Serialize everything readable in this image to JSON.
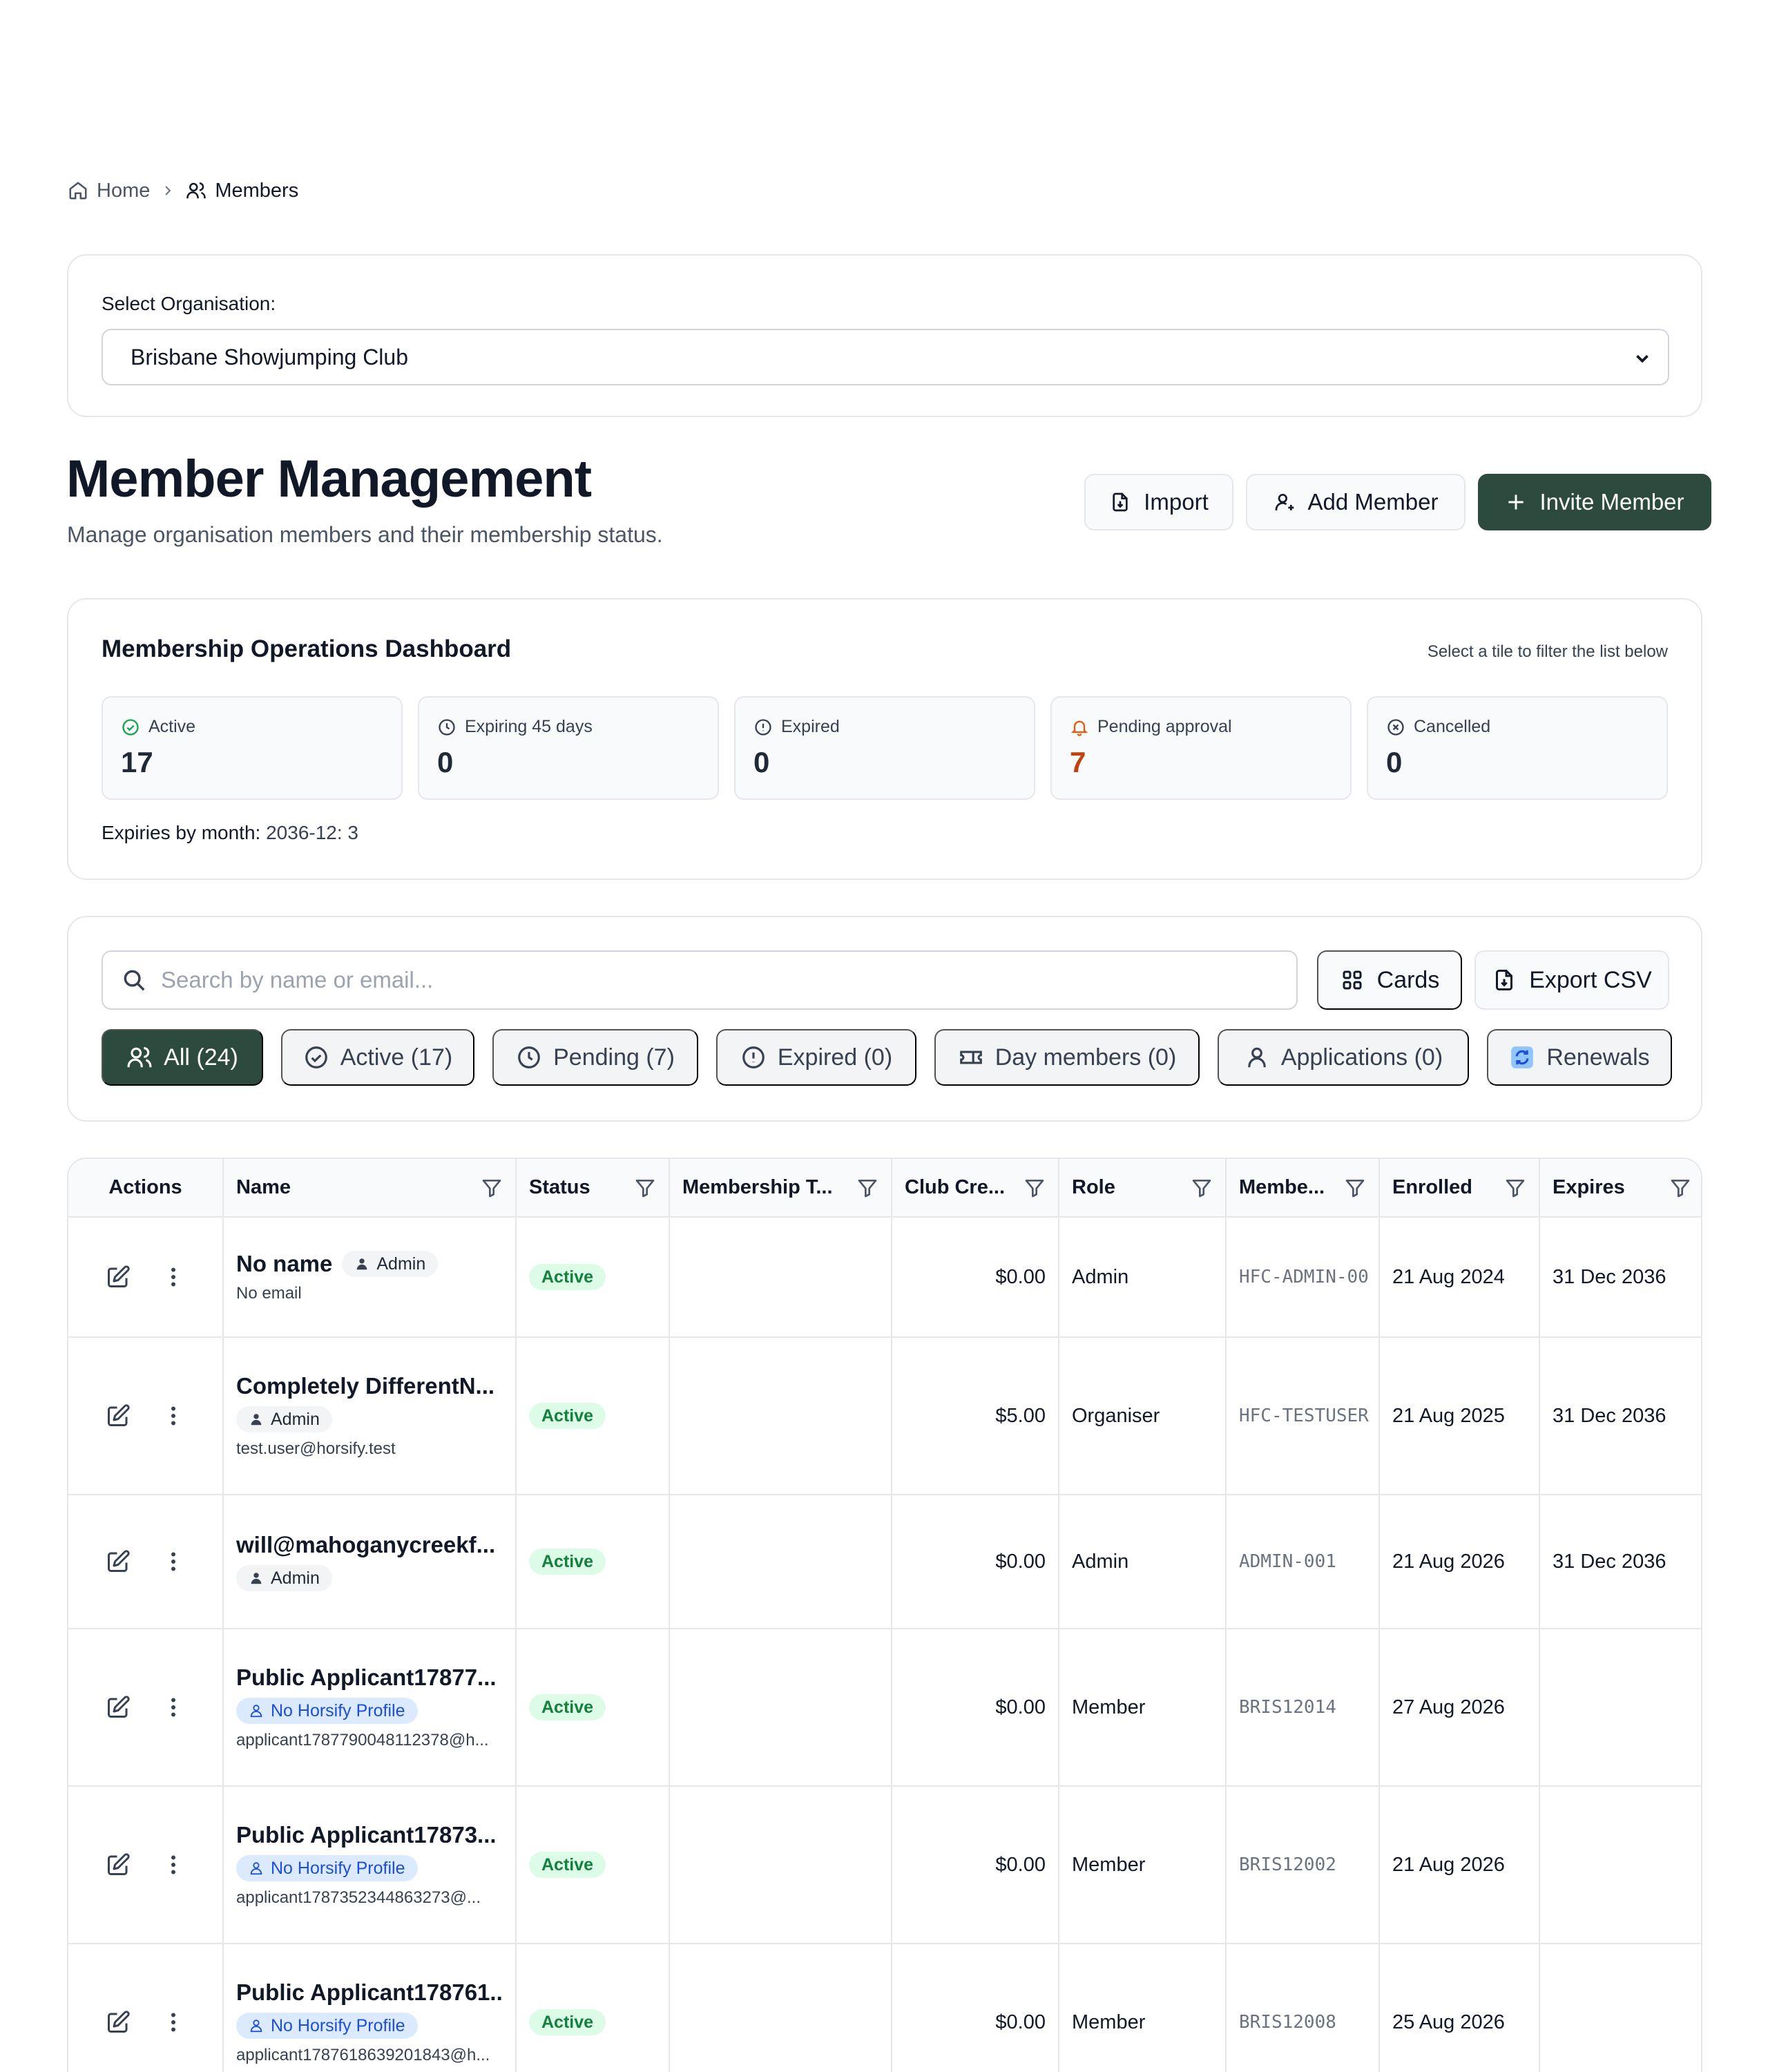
{
  "breadcrumb": {
    "home": "Home",
    "current": "Members"
  },
  "org": {
    "label": "Select Organisation:",
    "selected": "Brisbane Showjumping Club"
  },
  "header": {
    "title": "Member Management",
    "subtitle": "Manage organisation members and their membership status.",
    "import_label": "Import",
    "add_label": "Add Member",
    "invite_label": "Invite Member"
  },
  "dashboard": {
    "title": "Membership Operations Dashboard",
    "hint": "Select a tile to filter the list below",
    "tiles": [
      {
        "label": "Active",
        "value": "17",
        "icon": "check-circle-icon"
      },
      {
        "label": "Expiring 45 days",
        "value": "0",
        "icon": "clock-icon"
      },
      {
        "label": "Expired",
        "value": "0",
        "icon": "alert-circle-icon"
      },
      {
        "label": "Pending approval",
        "value": "7",
        "icon": "bell-icon"
      },
      {
        "label": "Cancelled",
        "value": "0",
        "icon": "x-circle-icon"
      }
    ],
    "expiries_label": "Expiries by month:",
    "expiries_value": "2036-12: 3"
  },
  "toolbar": {
    "search_placeholder": "Search by name or email...",
    "cards_label": "Cards",
    "export_label": "Export CSV",
    "filters": [
      "All (24)",
      "Active (17)",
      "Pending (7)",
      "Expired (0)",
      "Day members (0)",
      "Applications (0)",
      "Renewals"
    ]
  },
  "table": {
    "headers": [
      "Actions",
      "Name",
      "Status",
      "Membership T...",
      "Club Cre...",
      "Role",
      "Membe...",
      "Enrolled",
      "Expires"
    ],
    "rows": [
      {
        "name": "No name",
        "badge": "Admin",
        "email": "No email",
        "status": "Active",
        "membership": "",
        "credit": "$0.00",
        "role": "Admin",
        "member_no": "HFC-ADMIN-00",
        "enrolled": "21 Aug 2024",
        "expires": "31 Dec 2036"
      },
      {
        "name": "Completely DifferentN...",
        "badge": "Admin",
        "email": "test.user@horsify.test",
        "status": "Active",
        "membership": "",
        "credit": "$5.00",
        "role": "Organiser",
        "member_no": "HFC-TESTUSER",
        "enrolled": "21 Aug 2025",
        "expires": "31 Dec 2036"
      },
      {
        "name": "will@mahoganycreekf...",
        "badge": "Admin",
        "email": "",
        "status": "Active",
        "membership": "",
        "credit": "$0.00",
        "role": "Admin",
        "member_no": "ADMIN-001",
        "enrolled": "21 Aug 2026",
        "expires": "31 Dec 2036"
      },
      {
        "name": "Public Applicant17877...",
        "badge": "No Horsify Profile",
        "email": "applicant1787790048112378@h...",
        "status": "Active",
        "membership": "",
        "credit": "$0.00",
        "role": "Member",
        "member_no": "BRIS12014",
        "enrolled": "27 Aug 2026",
        "expires": ""
      },
      {
        "name": "Public Applicant17873...",
        "badge": "No Horsify Profile",
        "email": "applicant1787352344863273@...",
        "status": "Active",
        "membership": "",
        "credit": "$0.00",
        "role": "Member",
        "member_no": "BRIS12002",
        "enrolled": "21 Aug 2026",
        "expires": ""
      },
      {
        "name": "Public Applicant178761...",
        "badge": "No Horsify Profile",
        "email": "applicant1787618639201843@h...",
        "status": "Active",
        "membership": "",
        "credit": "$0.00",
        "role": "Member",
        "member_no": "BRIS12008",
        "enrolled": "25 Aug 2026",
        "expires": ""
      }
    ]
  }
}
